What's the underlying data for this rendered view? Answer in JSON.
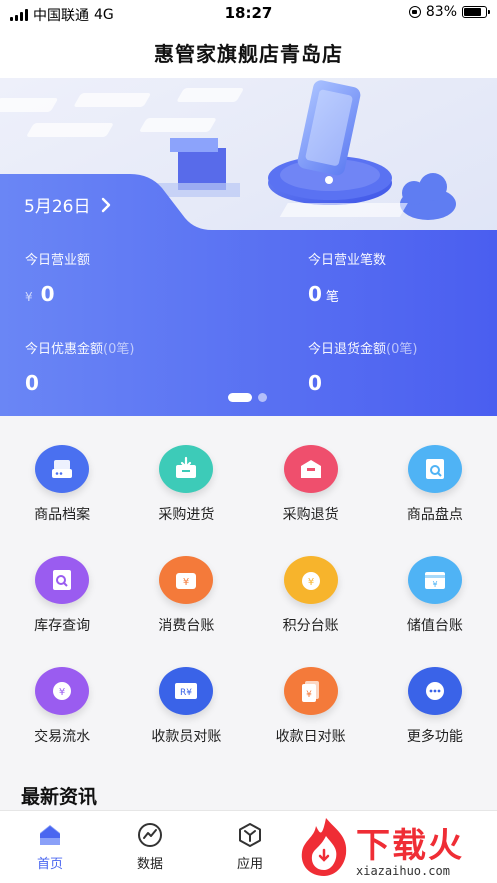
{
  "status_bar": {
    "carrier": "中国联通",
    "network": "4G",
    "time": "18:27",
    "battery": "83%",
    "battery_level": 0.83
  },
  "header": {
    "title": "惠管家旗舰店青岛店"
  },
  "banner": {
    "date": "5月26日",
    "stats": [
      {
        "label": "今日营业额",
        "note": "",
        "currency": "¥",
        "value": "0",
        "unit": ""
      },
      {
        "label": "今日营业笔数",
        "note": "",
        "currency": "",
        "value": "0",
        "unit": "笔"
      },
      {
        "label": "今日优惠金额",
        "note": "(0笔)",
        "currency": "",
        "value": "0",
        "unit": ""
      },
      {
        "label": "今日退货金额",
        "note": "(0笔)",
        "currency": "",
        "value": "0",
        "unit": ""
      }
    ],
    "page_count": 2,
    "active_page": 1
  },
  "grid": [
    {
      "label": "商品档案",
      "icon": "product-file-icon",
      "color": "#4a70f0"
    },
    {
      "label": "采购进货",
      "icon": "purchase-in-icon",
      "color": "#3dcbb8"
    },
    {
      "label": "采购退货",
      "icon": "purchase-return-icon",
      "color": "#ef4f6d"
    },
    {
      "label": "商品盘点",
      "icon": "inventory-check-icon",
      "color": "#4fb3f5"
    },
    {
      "label": "库存查询",
      "icon": "stock-query-icon",
      "color": "#9a5cf0"
    },
    {
      "label": "消费台账",
      "icon": "consume-ledger-icon",
      "color": "#f47a3a"
    },
    {
      "label": "积分台账",
      "icon": "points-ledger-icon",
      "color": "#f7b42c"
    },
    {
      "label": "储值台账",
      "icon": "stored-value-icon",
      "color": "#4fb3f5"
    },
    {
      "label": "交易流水",
      "icon": "transaction-flow-icon",
      "color": "#9a5cf0"
    },
    {
      "label": "收款员对账",
      "icon": "cashier-reconcile-icon",
      "color": "#3a63e8"
    },
    {
      "label": "收款日对账",
      "icon": "daily-reconcile-icon",
      "color": "#f47a3a"
    },
    {
      "label": "更多功能",
      "icon": "more-icon",
      "color": "#3a63e8"
    }
  ],
  "news": {
    "title": "最新资讯"
  },
  "tabs": [
    {
      "label": "首页",
      "icon": "home-icon",
      "active": true
    },
    {
      "label": "数据",
      "icon": "chart-icon",
      "active": false
    },
    {
      "label": "应用",
      "icon": "app-icon",
      "active": false
    }
  ],
  "watermark": {
    "text": "下载火",
    "domain": "xiazaihuo.com"
  },
  "colors": {
    "accent": "#4a66f0",
    "banner_start": "#6a86f5",
    "banner_end": "#4a5ef0"
  }
}
